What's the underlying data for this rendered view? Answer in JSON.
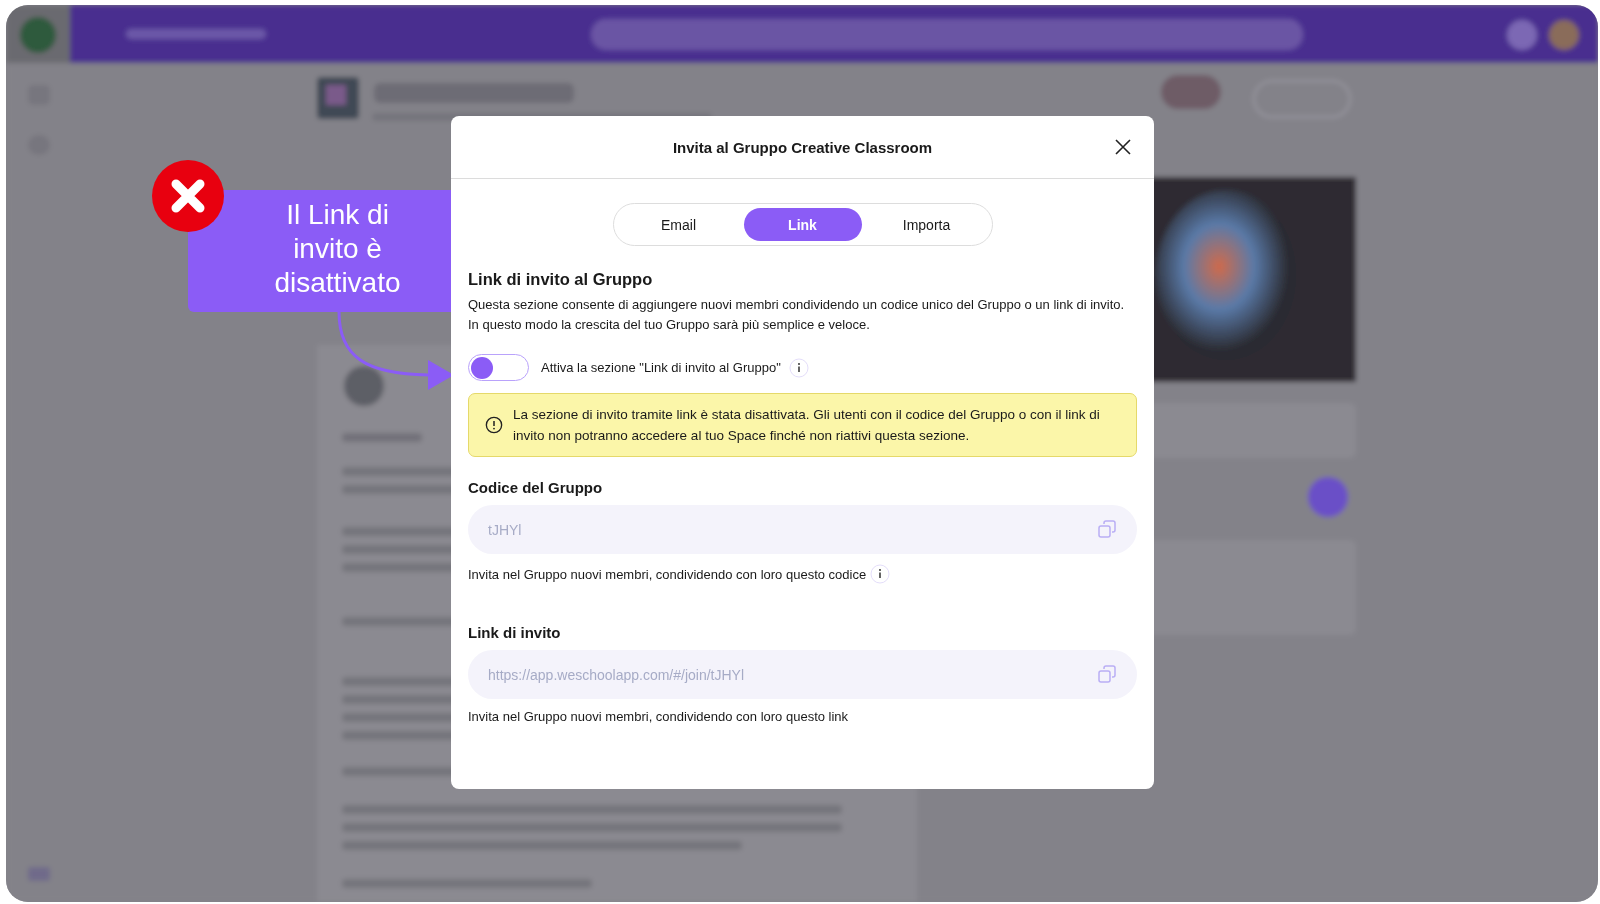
{
  "modal": {
    "title": "Invita al Gruppo Creative Classroom",
    "tabs": [
      {
        "label": "Email",
        "selected": false
      },
      {
        "label": "Link",
        "selected": true
      },
      {
        "label": "Importa",
        "selected": false
      }
    ],
    "section_title": "Link di invito al Gruppo",
    "description": "Questa sezione consente di aggiungere nuovi membri condividendo un codice unico del Gruppo o un link di invito. In questo modo la crescita del tuo Gruppo sarà più semplice e veloce.",
    "toggle": {
      "label": "Attiva la sezione \"Link di invito al Gruppo\"",
      "on": false
    },
    "alert": "La sezione di invito tramite link è stata disattivata. Gli utenti con il codice del Gruppo o con il link di invito non potranno accedere al tuo Space finché non riattivi questa sezione.",
    "code_section": {
      "title": "Codice del Gruppo",
      "value": "tJHYl",
      "hint": "Invita nel Gruppo nuovi membri, condividendo con loro questo codice",
      "info": true
    },
    "link_section": {
      "title": "Link di invito",
      "value": "https://app.weschoolapp.com/#/join/tJHYl",
      "hint": "Invita nel Gruppo nuovi membri, condividendo con loro questo link",
      "info": false
    }
  },
  "callout": {
    "text": "Il Link di invito è disattivato"
  }
}
